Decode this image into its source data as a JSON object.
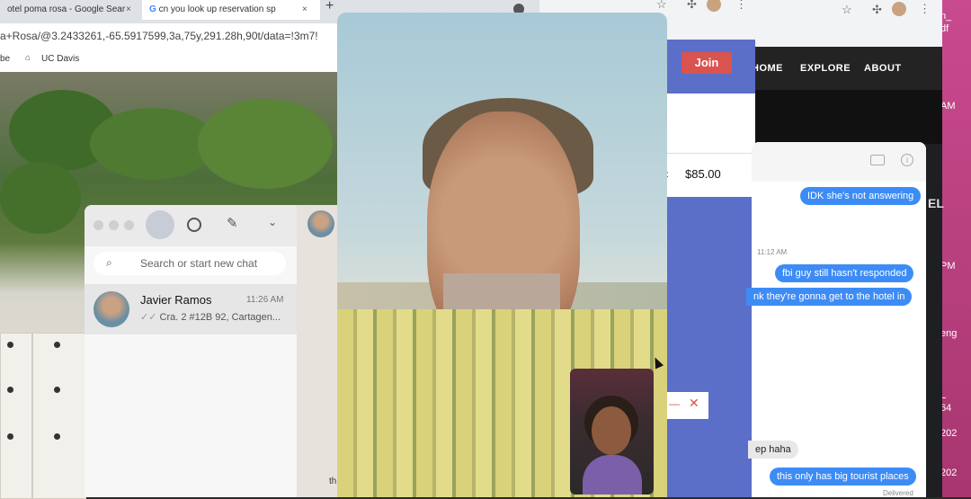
{
  "browser": {
    "tabs": [
      "otel poma rosa - Google Sear",
      "cn you look up reservation sp"
    ],
    "new_tab_symbol": "+",
    "url": "a+Rosa/@3.2433261,-65.5917599,3a,75y,291.28h,90t/data=!3m7!",
    "bookmarks": [
      "be",
      "UC Davis"
    ]
  },
  "booking": {
    "join_label": "Join",
    "price_label": "s:",
    "price": "$85.00",
    "close_symbol": "✕",
    "minimize_symbol": "—"
  },
  "site_nav": {
    "items": [
      "HOME",
      "EXPLORE",
      "ABOUT"
    ]
  },
  "side_fragments": {
    "pink": [
      "n_",
      "df",
      "AM",
      "PM",
      "eng",
      "L",
      "64",
      "202",
      "202"
    ],
    "dark": [
      "EL"
    ]
  },
  "messages": {
    "bubbles_out": [
      "IDK she's not answering",
      "fbi guy still hasn't responded",
      "nk they're gonna get to the hotel in",
      "this only has big tourist places"
    ],
    "bubbles_in": [
      "ep haha"
    ],
    "timestamp": "11:12 AM",
    "delivered": "Delivered"
  },
  "chat_app": {
    "search_placeholder": "Search or start new chat",
    "contact": {
      "name": "Javier Ramos",
      "time": "11:26 AM",
      "preview": "Cra. 2 #12B 92, Cartagen..."
    },
    "right_fragment": "th"
  }
}
